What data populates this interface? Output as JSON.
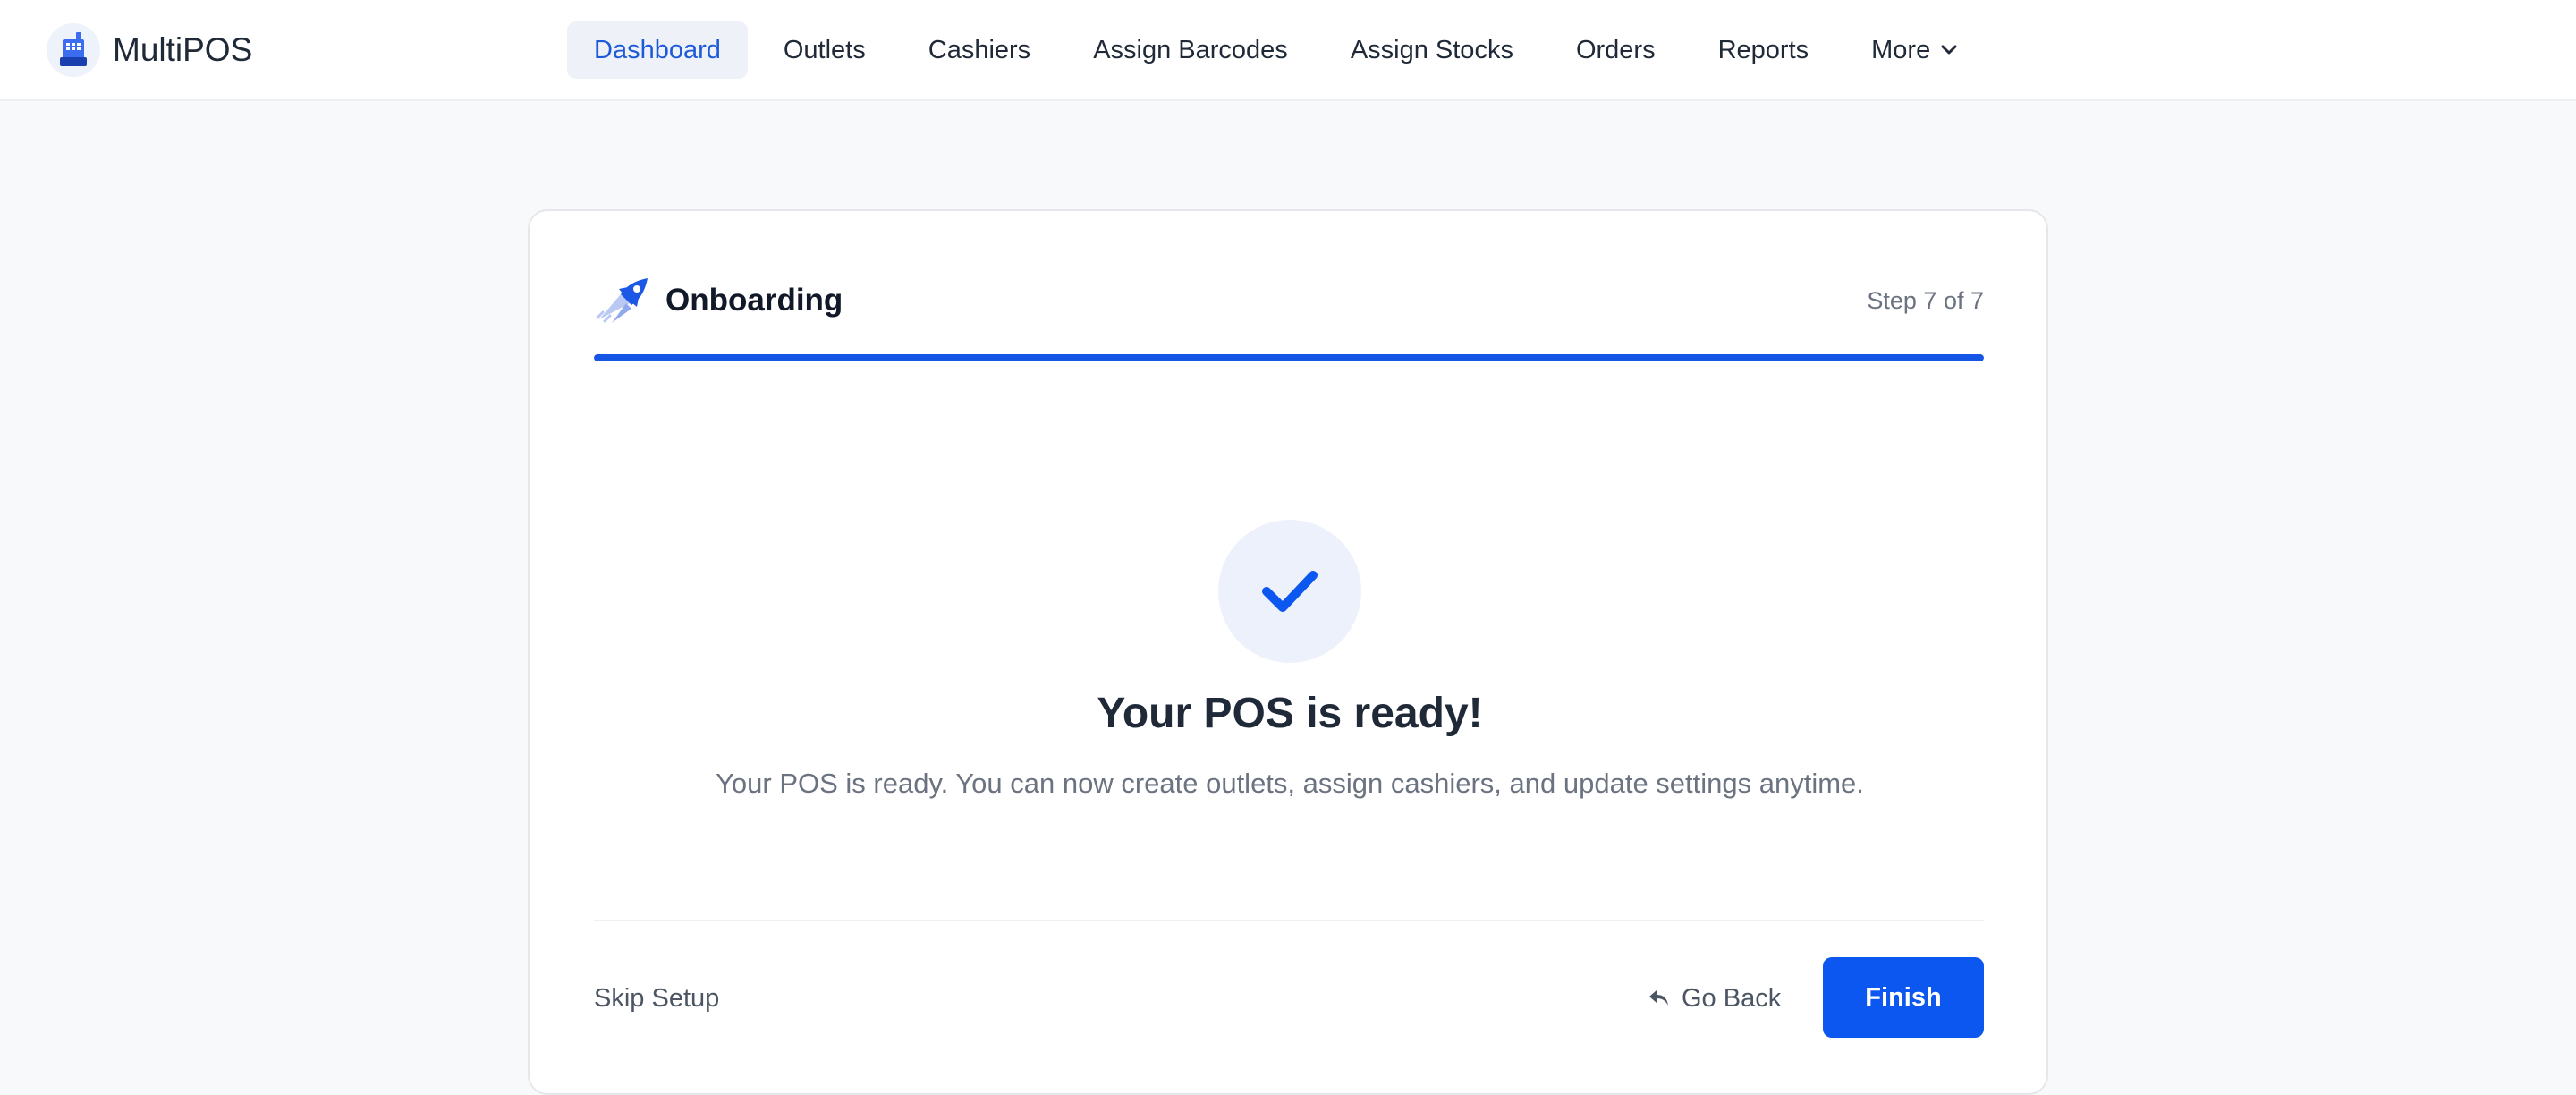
{
  "app": {
    "name": "MultiPOS",
    "logo_icon": "pos-terminal-icon"
  },
  "nav": {
    "items": [
      {
        "label": "Dashboard",
        "active": true
      },
      {
        "label": "Outlets",
        "active": false
      },
      {
        "label": "Cashiers",
        "active": false
      },
      {
        "label": "Assign Barcodes",
        "active": false
      },
      {
        "label": "Assign Stocks",
        "active": false
      },
      {
        "label": "Orders",
        "active": false
      },
      {
        "label": "Reports",
        "active": false
      },
      {
        "label": "More",
        "active": false,
        "icon": "chevron-down-icon"
      }
    ]
  },
  "onboarding": {
    "title": "Onboarding",
    "title_icon": "rocket-icon",
    "step_label": "Step 7 of 7",
    "progress_fraction": 1.0,
    "status_icon": "checkmark-icon",
    "headline": "Your POS is ready!",
    "message": "Your POS is ready. You can now create outlets, assign cashiers, and update settings anytime.",
    "skip_label": "Skip Setup",
    "back_label": "Go Back",
    "back_icon": "reply-arrow-icon",
    "finish_label": "Finish"
  },
  "colors": {
    "accent": "#0b57f0",
    "active_nav_bg": "#eef2f8",
    "active_nav_text": "#1d5ad8",
    "success_circle_bg": "#edf1fb"
  }
}
